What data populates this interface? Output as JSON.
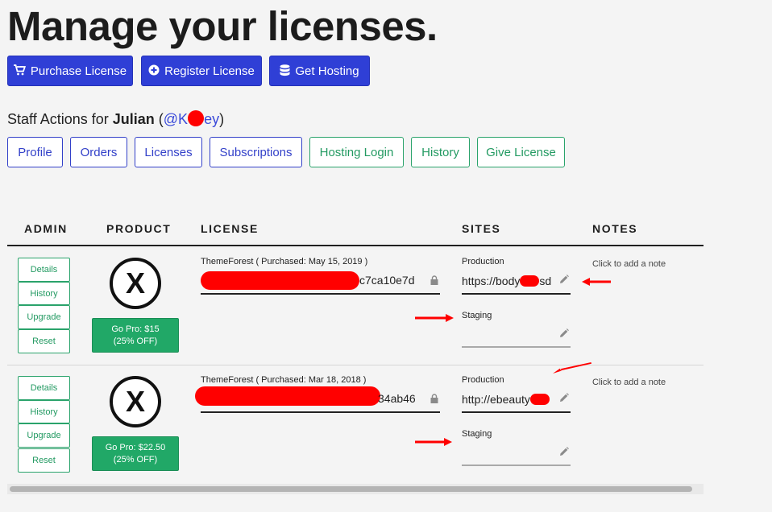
{
  "header": {
    "title": "Manage your licenses."
  },
  "actions": [
    {
      "label": "Purchase License",
      "icon": "cart-icon"
    },
    {
      "label": "Register License",
      "icon": "plus-circle-icon"
    },
    {
      "label": "Get Hosting",
      "icon": "database-icon"
    }
  ],
  "staff": {
    "prefix": "Staff Actions for ",
    "name": "Julian",
    "handle_prefix": "@K",
    "handle_suffix": "ey",
    "open_paren": "(",
    "close_paren": ")"
  },
  "staff_buttons": [
    {
      "label": "Profile",
      "style": "blue"
    },
    {
      "label": "Orders",
      "style": "blue"
    },
    {
      "label": "Licenses",
      "style": "blue"
    },
    {
      "label": "Subscriptions",
      "style": "blue"
    },
    {
      "label": "Hosting Login",
      "style": "green"
    },
    {
      "label": "History",
      "style": "green"
    },
    {
      "label": "Give License",
      "style": "green"
    }
  ],
  "table": {
    "headers": [
      "ADMIN",
      "PRODUCT",
      "LICENSE",
      "SITES",
      "NOTES"
    ],
    "rows": [
      {
        "admin_buttons": [
          "Details",
          "History",
          "Upgrade",
          "Reset"
        ],
        "product_logo": "X",
        "gopro_line1": "Go Pro: $15",
        "gopro_line2": "(25% OFF)",
        "license_source": "ThemeForest ( Purchased: May 15, 2019 )",
        "license_key_visible": "c7ca10e7d",
        "production_label": "Production",
        "production_value": "https://body",
        "production_value_tail": "sd",
        "staging_label": "Staging",
        "staging_value": "",
        "note": "Click to add a note"
      },
      {
        "admin_buttons": [
          "Details",
          "History",
          "Upgrade",
          "Reset"
        ],
        "product_logo": "X",
        "gopro_line1": "Go Pro: $22.50",
        "gopro_line2": "(25% OFF)",
        "license_source": "ThemeForest ( Purchased: Mar 18, 2018 )",
        "license_key_visible": "34ab46",
        "production_label": "Production",
        "production_value": "http://ebeauty",
        "production_value_tail": "",
        "staging_label": "Staging",
        "staging_value": "",
        "note": "Click to add a note"
      }
    ]
  },
  "colors": {
    "primary": "#2f3fd6",
    "success": "#21a867",
    "outline_green": "#2aa36b",
    "redaction": "#ff0000",
    "background": "#f4f4f4"
  }
}
